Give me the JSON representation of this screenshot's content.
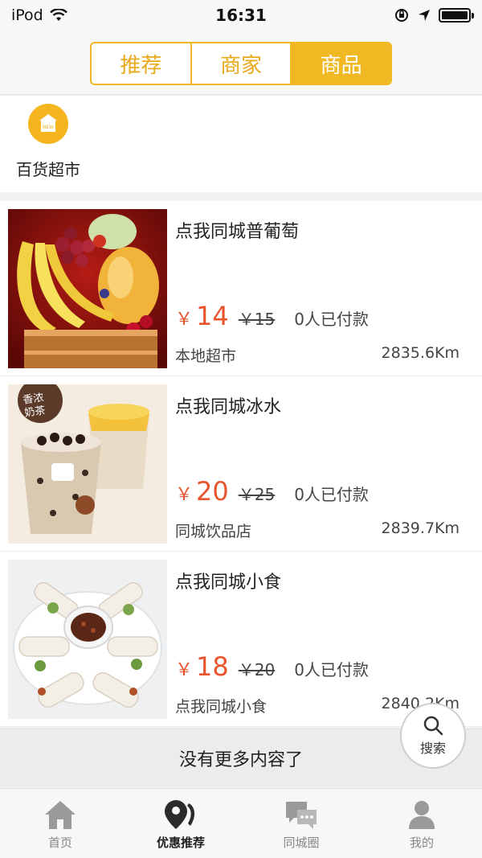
{
  "status_bar": {
    "device": "iPod",
    "time": "16:31"
  },
  "segments": [
    {
      "label": "推荐",
      "active": false
    },
    {
      "label": "商家",
      "active": false
    },
    {
      "label": "商品",
      "active": true
    }
  ],
  "category": {
    "label": "百货超市",
    "icon": "new-store-icon"
  },
  "products": [
    {
      "title": "点我同城普葡萄",
      "currency": "￥",
      "price": "14",
      "orig_price": "￥15",
      "paid": "0人已付款",
      "shop": "本地超市",
      "distance": "2835.6Km",
      "image": "fruit-basket"
    },
    {
      "title": "点我同城冰水",
      "currency": "￥",
      "price": "20",
      "orig_price": "￥25",
      "paid": "0人已付款",
      "shop": "同城饮品店",
      "distance": "2839.7Km",
      "image": "milk-tea"
    },
    {
      "title": "点我同城小食",
      "currency": "￥",
      "price": "18",
      "orig_price": "￥20",
      "paid": "0人已付款",
      "shop": "点我同城小食",
      "distance": "2840.2Km",
      "image": "spring-rolls"
    }
  ],
  "no_more_text": "没有更多内容了",
  "search_fab": {
    "label": "搜索"
  },
  "tabs": [
    {
      "label": "首页",
      "icon": "home-icon",
      "active": false
    },
    {
      "label": "优惠推荐",
      "icon": "map-pin-icon",
      "active": true
    },
    {
      "label": "同城圈",
      "icon": "chat-bubbles-icon",
      "active": false
    },
    {
      "label": "我的",
      "icon": "user-icon",
      "active": false
    }
  ],
  "colors": {
    "accent": "#f0b823",
    "price": "#e8542c"
  }
}
